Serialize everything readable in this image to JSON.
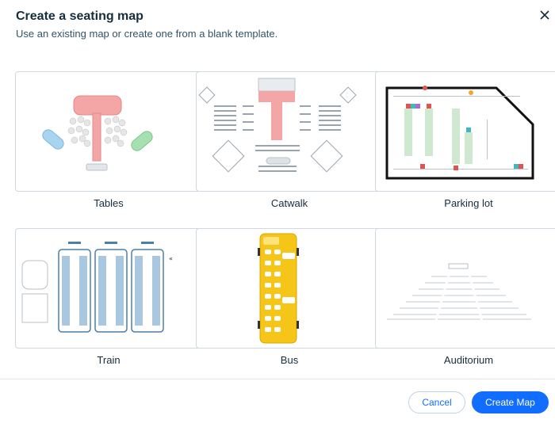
{
  "dialog": {
    "title": "Create a seating map",
    "subtitle": "Use an existing map or create one from a blank template.",
    "close_icon": "close-icon"
  },
  "templates": [
    {
      "label": "Tables"
    },
    {
      "label": "Catwalk"
    },
    {
      "label": "Parking lot"
    },
    {
      "label": "Train"
    },
    {
      "label": "Bus"
    },
    {
      "label": "Auditorium"
    }
  ],
  "footer": {
    "cancel_label": "Cancel",
    "create_label": "Create Map"
  },
  "colors": {
    "accent": "#116dff",
    "stage_pink": "#f4a6a6",
    "table_blue": "#a9d4f0",
    "table_green": "#a6e0b0",
    "bus_yellow": "#f5c518",
    "train_blue": "#4a7fa8"
  }
}
